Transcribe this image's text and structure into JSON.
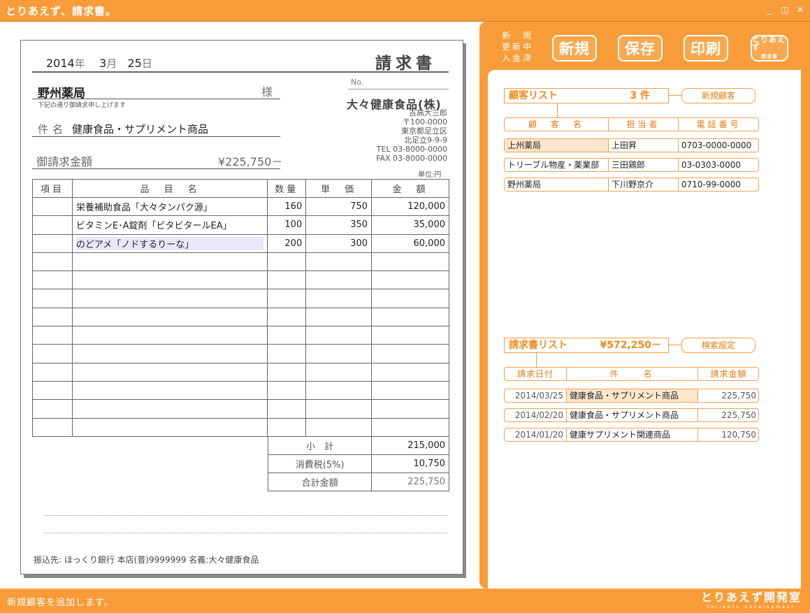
{
  "window": {
    "title": "とりあえず、請求書。",
    "minimize": "_",
    "restore": "◫",
    "close": "✕"
  },
  "toolbar": {
    "modes": [
      "新　規",
      "更新中",
      "入金済"
    ],
    "new_label": "新規",
    "save_label": "保存",
    "print_label": "印刷",
    "logo_label_top": "とりあえず",
    "logo_label_bottom": "請求書"
  },
  "invoice": {
    "year": "2014",
    "year_unit": "年",
    "month": "3",
    "month_unit": "月",
    "day": "25",
    "day_unit": "日",
    "doc_title": "請求書",
    "customer": "野州薬局",
    "honorific": "様",
    "subtitle": "下記の通り御請求申し上げます",
    "subject_label": "件名",
    "subject": "健康食品・サプリメント商品",
    "amount_label": "御請求金額",
    "amount": "¥225,750－",
    "no_label": "No.",
    "company": "大々健康食品(株)",
    "address_lines": [
      "吉高大三郎",
      "〒100-0000",
      "東京都足立区",
      "北足立9-9-9",
      "TEL 03-8000-0000",
      "FAX 03-8000-0000"
    ],
    "unit_note": "単位:円",
    "columns": [
      "項目",
      "品　目　名",
      "数量",
      "単　価",
      "金　額"
    ],
    "rows": [
      {
        "item": "",
        "name": "栄養補助食品「大々タンパク源」",
        "qty": "160",
        "price": "750",
        "amount": "120,000"
      },
      {
        "item": "",
        "name": "ビタミンE･A錠剤「ビタビタールEA」",
        "qty": "100",
        "price": "350",
        "amount": "35,000"
      },
      {
        "item": "",
        "name": "のどアメ「ノドするりーな」",
        "qty": "200",
        "price": "300",
        "amount": "60,000"
      }
    ],
    "empty_rows": 10,
    "subtotal_label": "小　計",
    "subtotal": "215,000",
    "tax_label": "消費税(5%)",
    "tax": "10,750",
    "total_label": "合計金額",
    "total": "225,750",
    "bank": "振込先: ほっくり銀行 本店(普)9999999 名義:大々健康食品"
  },
  "customer_list": {
    "title": "顧客リスト",
    "count": "3 件",
    "new_button": "新規顧客",
    "columns": [
      "顧　客　名",
      "担当者",
      "電話番号"
    ],
    "rows": [
      {
        "name": "上州薬局",
        "contact": "上田昇",
        "phone": "0703-0000-0000"
      },
      {
        "name": "トリーブル物産・薬業部",
        "contact": "三田鶏郎",
        "phone": "03-0303-0000"
      },
      {
        "name": "野州薬局",
        "contact": "下川野京介",
        "phone": "0710-99-0000"
      }
    ]
  },
  "invoice_list": {
    "title": "請求書リスト",
    "total": "¥572,250－",
    "search_button": "検索設定",
    "columns": [
      "請求日付",
      "件　　名",
      "請求金額"
    ],
    "rows": [
      {
        "date": "2014/03/25",
        "subject": "健康食品・サプリメント商品",
        "amount": "225,750"
      },
      {
        "date": "2014/02/20",
        "subject": "健康食品・サプリメント商品",
        "amount": "225,750"
      },
      {
        "date": "2014/01/20",
        "subject": "健康サプリメント関連商品",
        "amount": "120,750"
      }
    ]
  },
  "status": {
    "message": "新規顧客を追加します。",
    "brand": "とりあえず開発室",
    "brand_sub": "toriaezu development"
  }
}
